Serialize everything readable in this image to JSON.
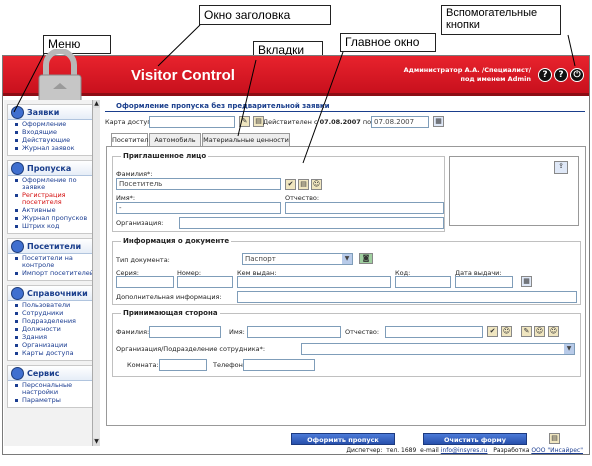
{
  "callouts": {
    "title": "Окно заголовка",
    "menu": "Меню",
    "tabs": "Вкладки",
    "main": "Главное окно",
    "aux": "Вспомогательные кнопки"
  },
  "header": {
    "app_title": "Visitor Control",
    "user_line1": "Администратор А.А. /Специалист/",
    "user_line2": "под именем Admin",
    "help1_icon": "question-icon",
    "help2_icon": "question-icon",
    "power_icon": "power-icon"
  },
  "sidebar": {
    "sections": [
      {
        "title": "Заявки",
        "icon": "requests-icon",
        "items": [
          "Оформление",
          "Входящие",
          "Действующие",
          "Журнал заявок"
        ]
      },
      {
        "title": "Пропуска",
        "icon": "passes-icon",
        "items": [
          "Оформление по заявке",
          "Регистрация посетителя",
          "Активные",
          "Журнал пропусков",
          "Штрих код"
        ]
      },
      {
        "title": "Посетители",
        "icon": "visitors-icon",
        "items": [
          "Посетители на контроле",
          "Импорт посетителей"
        ]
      },
      {
        "title": "Справочники",
        "icon": "directories-icon",
        "items": [
          "Пользователи",
          "Сотрудники",
          "Подразделения",
          "Должности",
          "Здания",
          "Организации",
          "Карты доступа"
        ]
      },
      {
        "title": "Сервис",
        "icon": "service-icon",
        "items": [
          "Персональные настройки",
          "Параметры"
        ]
      }
    ],
    "active_item": "Регистрация посетителя"
  },
  "form": {
    "title": "Оформление пропуска без предварительной заявки",
    "access_card_label": "Карта доступа:",
    "valid_label": "Действителен с",
    "valid_from": "07.08.2007",
    "valid_to_label": "по",
    "valid_to": "07.08.2007",
    "tabs": [
      "Посетитель",
      "Автомобиль",
      "Материальные ценности"
    ],
    "invited": {
      "legend": "Приглашенное лицо",
      "surname_label": "Фамилия*:",
      "surname_value": "Посетитель",
      "name_label": "Имя*:",
      "name_value": "-",
      "patronymic_label": "Отчество:",
      "org_label": "Организация:"
    },
    "document": {
      "legend": "Информация о документе",
      "doc_type_label": "Тип документа:",
      "doc_type_value": "Паспорт",
      "series_label": "Серия:",
      "number_label": "Номер:",
      "issued_by_label": "Кем выдан:",
      "code_label": "Код:",
      "issue_date_label": "Дата выдачи:",
      "extra_label": "Дополнительная информация:"
    },
    "host": {
      "legend": "Принимающая сторона",
      "surname_label": "Фамилия:",
      "name_label": "Имя:",
      "patronymic_label": "Отчество:",
      "org_label": "Организация/Подразделение сотрудника*:",
      "room_label": "Комната:",
      "phone_label": "Телефон:"
    },
    "buttons": {
      "submit": "Оформить пропуск",
      "clear": "Очистить форму"
    }
  },
  "status_bar": {
    "dispatcher": "Диспетчер:",
    "phone": "тел. 1689",
    "email_label": "e-mail",
    "email": "info@insyres.ru",
    "developer_label": "Разработка",
    "developer": "ООО \"Инсайрес\""
  }
}
